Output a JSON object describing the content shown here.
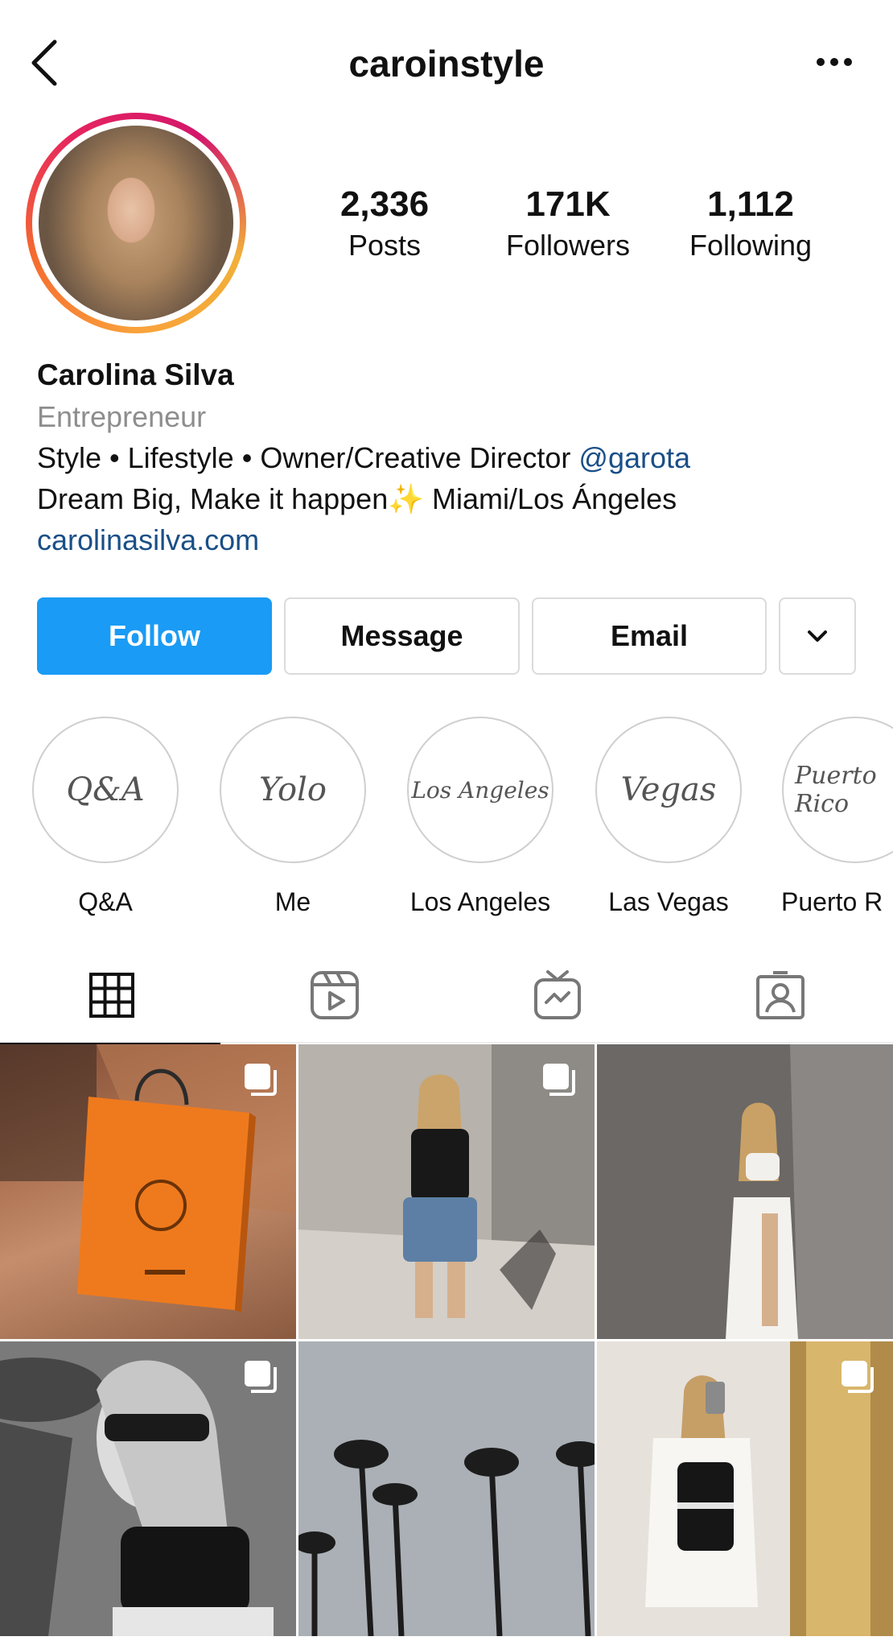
{
  "header": {
    "username": "caroinstyle",
    "back_icon": "chevron-left-icon",
    "more_icon": "more-horizontal-icon"
  },
  "stats": [
    {
      "value": "2,336",
      "label": "Posts"
    },
    {
      "value": "171K",
      "label": "Followers"
    },
    {
      "value": "1,112",
      "label": "Following"
    }
  ],
  "bio": {
    "name": "Carolina Silva",
    "category": "Entrepreneur",
    "line1_text": "Style • Lifestyle • Owner/Creative Director ",
    "line1_mention": "@garota",
    "line2": "Dream Big, Make it happen✨ Miami/Los Ángeles",
    "website": "carolinasilva.com"
  },
  "buttons": {
    "follow": "Follow",
    "message": "Message",
    "email": "Email",
    "dropdown_icon": "chevron-down-icon"
  },
  "highlights": [
    {
      "label": "Q&A",
      "cover_text": "Q&A"
    },
    {
      "label": "Me",
      "cover_text": "Yolo"
    },
    {
      "label": "Los Angeles",
      "cover_text": "Los Angeles"
    },
    {
      "label": "Las Vegas",
      "cover_text": "Vegas"
    },
    {
      "label": "Puerto R",
      "cover_text": "Puerto Rico"
    }
  ],
  "tabs": [
    "grid-icon",
    "reels-icon",
    "igtv-icon",
    "tagged-icon"
  ],
  "colors": {
    "follow_button": "#1a9bf5",
    "link": "#1a4f87",
    "secondary_text": "#8e8e8e"
  }
}
